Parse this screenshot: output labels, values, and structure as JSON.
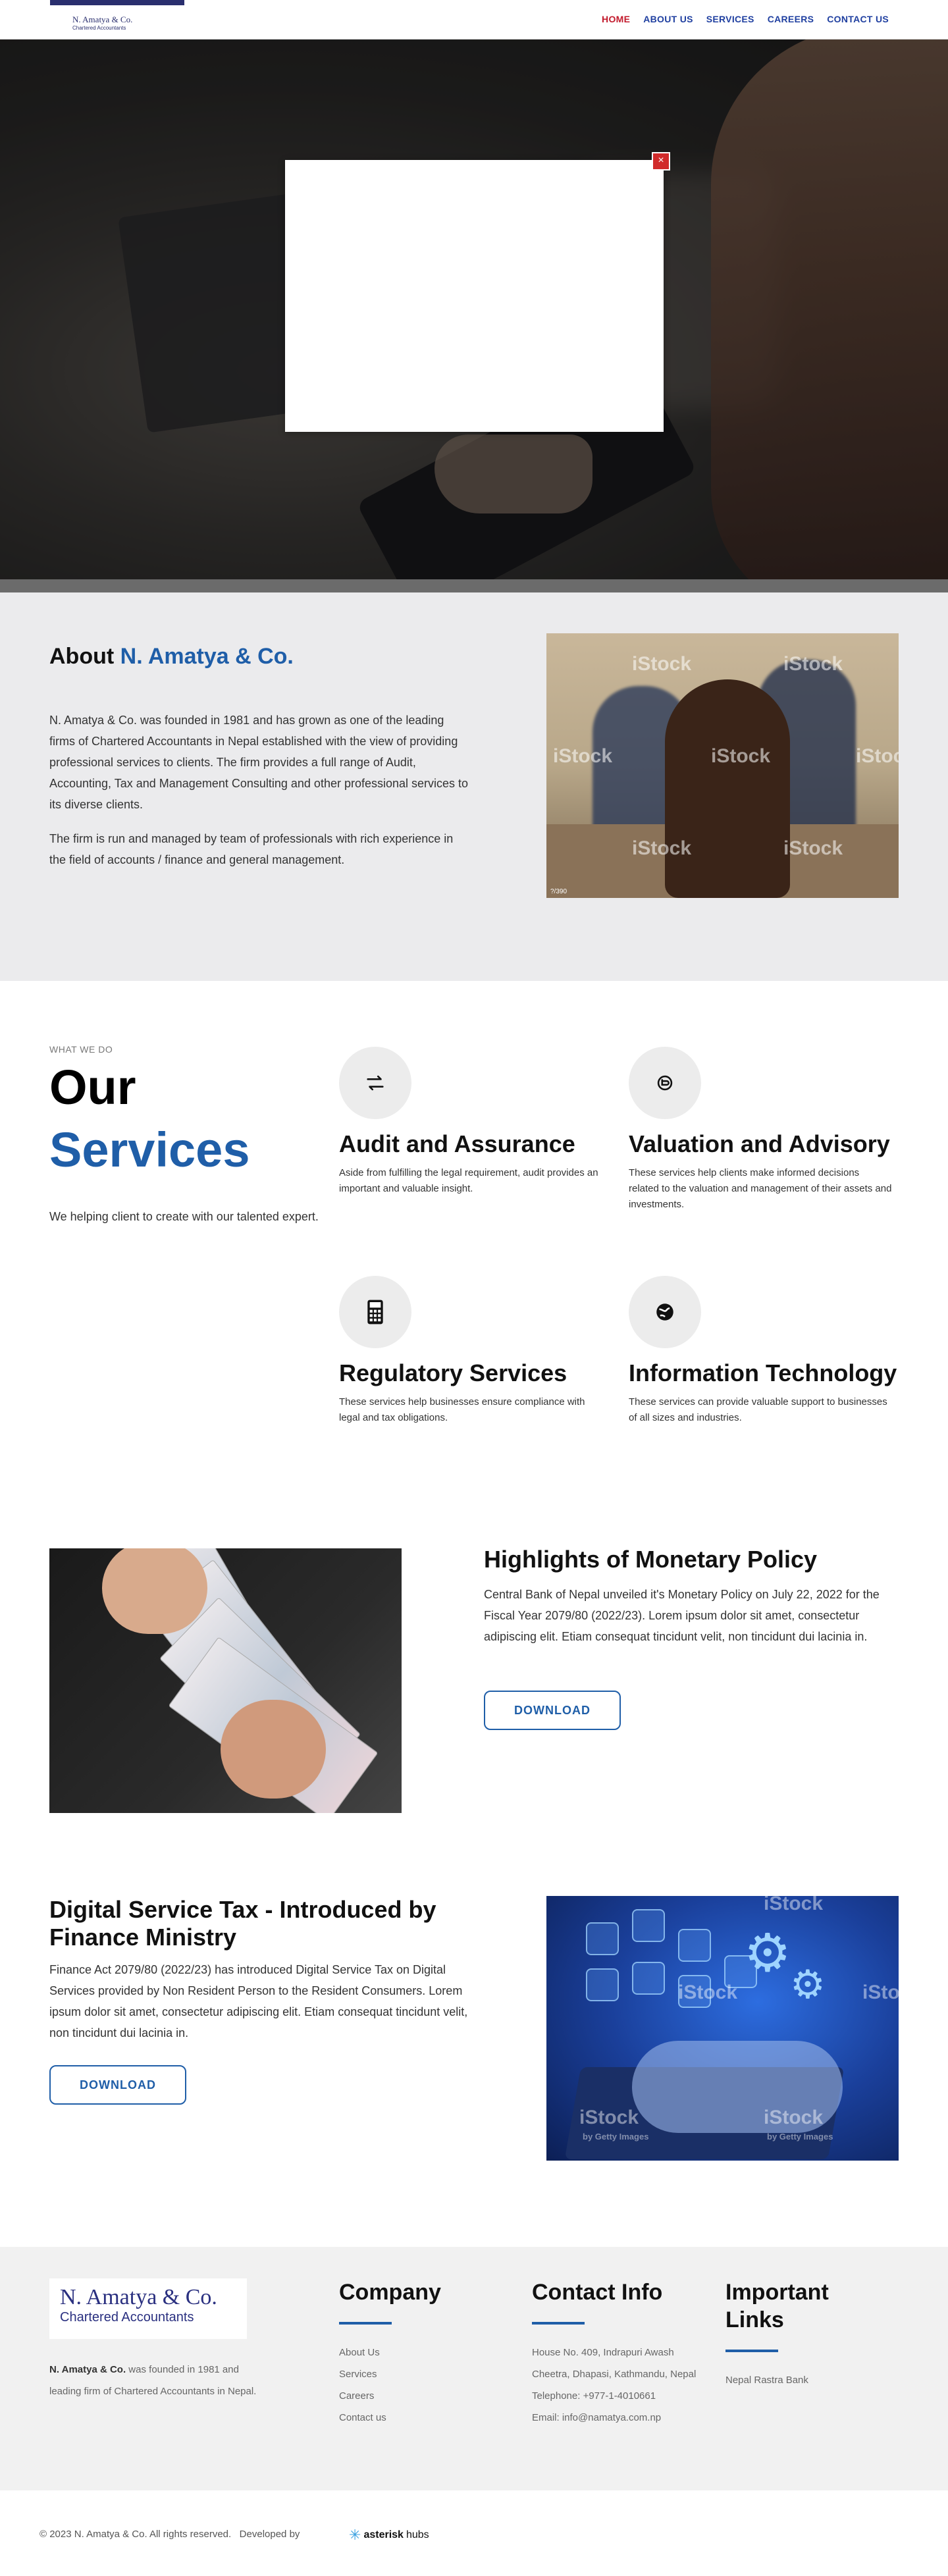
{
  "nav": {
    "logo_name": "N. Amatya & Co.",
    "logo_sub": "Chartered Accountants",
    "links": [
      {
        "label": "HOME",
        "active": true
      },
      {
        "label": "ABOUT US"
      },
      {
        "label": "SERVICES"
      },
      {
        "label": "CAREERS"
      },
      {
        "label": "CONTACT US"
      }
    ]
  },
  "modal": {
    "close_glyph": "×"
  },
  "about": {
    "title_prefix": "About",
    "title_brand": "N. Amatya & Co.",
    "paragraph1": "N. Amatya & Co. was founded in 1981 and has grown as one of the leading firms of Chartered Accountants in Nepal established with the view of providing professional services to clients. The firm provides a full range of Audit, Accounting, Tax and Management Consulting and other professional services to its diverse clients.",
    "paragraph2": "The firm is run and managed by team of professionals with rich experience in the field of accounts / finance and general management.",
    "image_watermark": "iStock",
    "image_id": "?/390"
  },
  "services": {
    "tag": "WHAT WE DO",
    "title_line1": "Our",
    "title_line2": "Services",
    "description": "We helping client to create with our talented expert.",
    "items": [
      {
        "title": "Audit and Assurance",
        "text": "Aside from fulfilling the legal requirement, audit provides an important and valuable insight.",
        "icon": "exchange-arrows-icon"
      },
      {
        "title": "Valuation and Advisory",
        "text": "These services help clients make informed decisions related to the valuation and management of their assets and investments.",
        "icon": "coins-icon"
      },
      {
        "title": "Regulatory Services",
        "text": "These services help businesses ensure compliance with legal and tax obligations.",
        "icon": "calculator-icon"
      },
      {
        "title": "Information Technology",
        "text": "These services can provide valuable support to businesses of all sizes and industries.",
        "icon": "globe-icon"
      }
    ]
  },
  "monetary": {
    "title": "Highlights of Monetary Policy",
    "text": "Central Bank of Nepal unveiled it's Monetary Policy on July 22, 2022 for the Fiscal Year 2079/80 (2022/23). Lorem ipsum dolor sit amet, consectetur adipiscing elit. Etiam consequat tincidunt velit, non tincidunt dui lacinia in.",
    "button": "DOWNLOAD"
  },
  "dst": {
    "title": "Digital Service Tax - Introduced by Finance Ministry",
    "text": "Finance Act 2079/80 (2022/23) has introduced Digital Service Tax on Digital Services provided by Non Resident Person to the Resident Consumers. Lorem ipsum dolor sit amet, consectetur adipiscing elit. Etiam consequat tincidunt velit, non tincidunt dui lacinia in.",
    "button": "DOWNLOAD",
    "image_watermark": "iStock",
    "image_watermark_sub": "by Getty Images"
  },
  "footer": {
    "logo_name": "N. Amatya & Co.",
    "logo_sub": "Chartered Accountants",
    "about_bold": "N. Amatya & Co.",
    "about_rest": " was founded in 1981 and leading firm of Chartered Accountants in Nepal.",
    "company": {
      "heading": "Company",
      "links": [
        "About Us",
        "Services",
        "Careers",
        "Contact us"
      ]
    },
    "contact": {
      "heading": "Contact Info",
      "address": "House No. 409, Indrapuri Awash Cheetra, Dhapasi, Kathmandu, Nepal",
      "telephone": "Telephone: +977-1-4010661",
      "email": "Email: info@namatya.com.np"
    },
    "important": {
      "heading": "Important Links",
      "links": [
        "Nepal Rastra Bank"
      ]
    }
  },
  "copyright": {
    "text": "© 2023 N. Amatya & Co. All rights reserved.   Developed by",
    "dev_bold": "asterisk",
    "dev_rest": "hubs"
  },
  "colors": {
    "brand_blue": "#1f5ea8",
    "nav_active": "#c2192b",
    "close_red": "#d12b2b"
  }
}
